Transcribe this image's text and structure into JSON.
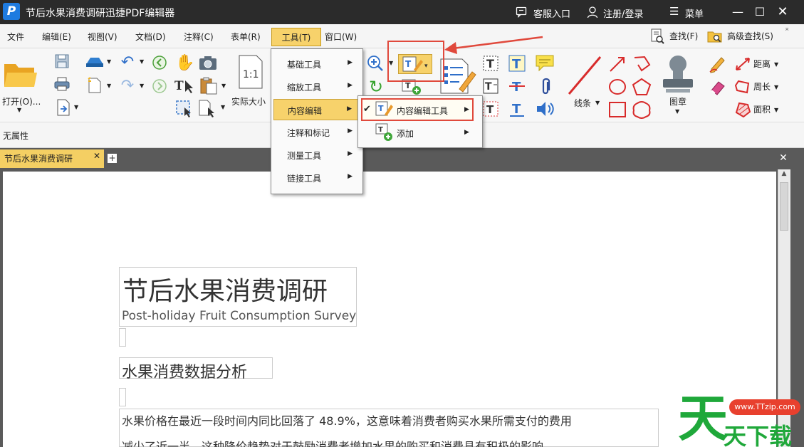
{
  "window": {
    "title": "节后水果消费调研迅捷PDF编辑器",
    "logo_letter": "P",
    "customer_service": "客服入口",
    "login": "注册/登录",
    "menu": "菜单"
  },
  "menubar": {
    "items": [
      "文件",
      "编辑(E)",
      "视图(V)",
      "文档(D)",
      "注释(C)",
      "表单(R)",
      "工具(T)",
      "窗口(W)"
    ],
    "search": "查找(F)",
    "advanced_search": "高级查找(S)"
  },
  "ribbon": {
    "open": "打开(O)...",
    "actual_size": "实际大小",
    "line": "线条",
    "stamp": "图章",
    "distance": "距离",
    "perimeter": "周长",
    "area": "面积",
    "ratio_icon_text": "1:1"
  },
  "property_bar": {
    "label": "无属性"
  },
  "tabs": {
    "document": "节后水果消费调研"
  },
  "tools_menu": {
    "items": [
      "基础工具",
      "缩放工具",
      "内容编辑",
      "注释和标记",
      "测量工具",
      "链接工具"
    ]
  },
  "content_edit_menu": {
    "items": [
      "内容编辑工具",
      "添加"
    ]
  },
  "document": {
    "title": "节后水果消费调研",
    "subtitle": "Post-holiday Fruit Consumption Survey",
    "heading": "水果消费数据分析",
    "para_line1": "水果价格在最近一段时间内同比回落了  48.9%，这意味着消费者购买水果所需支付的费用",
    "para_line2": "减少了近一半，这种降价趋势对于鼓励消费者增加水果的购买和消费具有积极的影响"
  },
  "watermark": {
    "char": "天",
    "url": "www.TTzip.com",
    "text": "天下载"
  },
  "colors": {
    "titlebar": "#2b2b2b",
    "active_menu": "#f7d26b",
    "highlight": "#e0493c",
    "watermark_green": "#1fa83a"
  }
}
